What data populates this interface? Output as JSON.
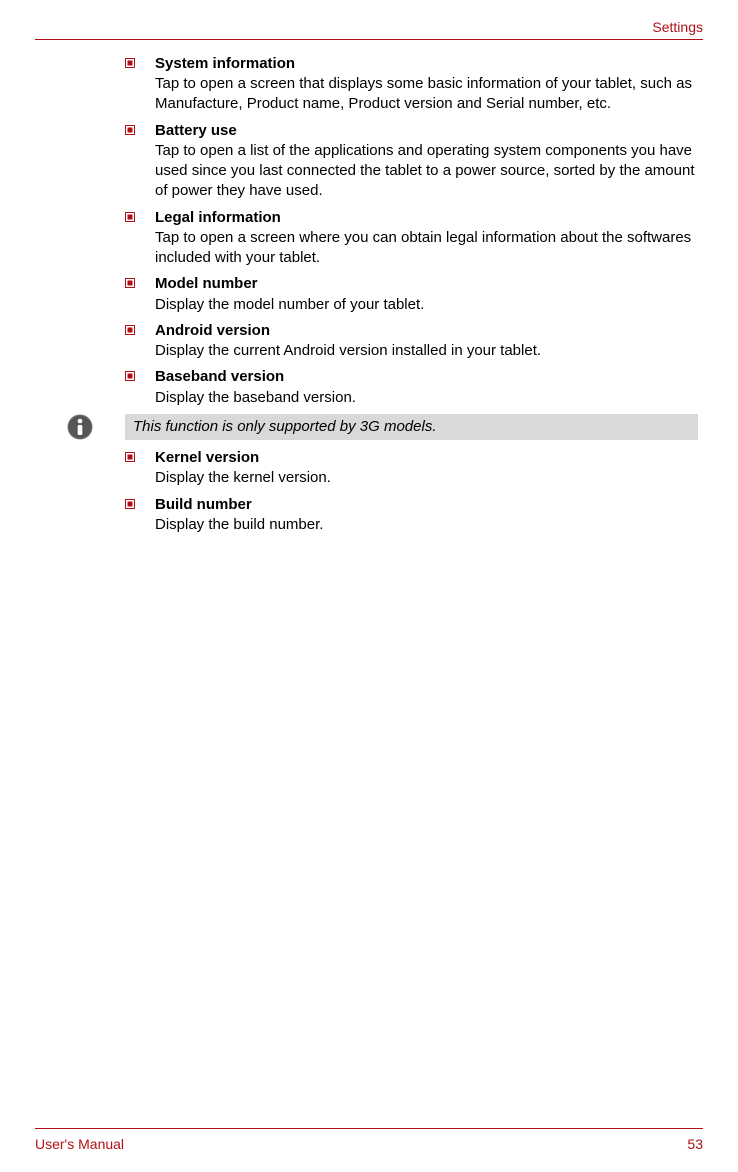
{
  "header": {
    "section": "Settings"
  },
  "items_a": [
    {
      "title": "System information",
      "desc": "Tap to open a screen that displays some basic information of your tablet, such as Manufacture, Product name, Product version and Serial number, etc."
    },
    {
      "title": "Battery use",
      "desc": "Tap to open a list of the applications and operating system components you have used since you last connected the tablet to a power source, sorted by the amount of power they have used."
    },
    {
      "title": "Legal information",
      "desc": "Tap to open a screen where you can obtain legal information about the softwares included with your tablet."
    },
    {
      "title": "Model number",
      "desc": "Display the model number of your tablet."
    },
    {
      "title": "Android version",
      "desc": "Display the current Android version installed in your tablet."
    },
    {
      "title": "Baseband version",
      "desc": "Display the baseband version."
    }
  ],
  "note": {
    "text": "This function is only supported by 3G models."
  },
  "items_b": [
    {
      "title": "Kernel version",
      "desc": "Display the kernel version."
    },
    {
      "title": "Build number",
      "desc": "Display the build number."
    }
  ],
  "footer": {
    "left": "User's Manual",
    "right": "53"
  }
}
